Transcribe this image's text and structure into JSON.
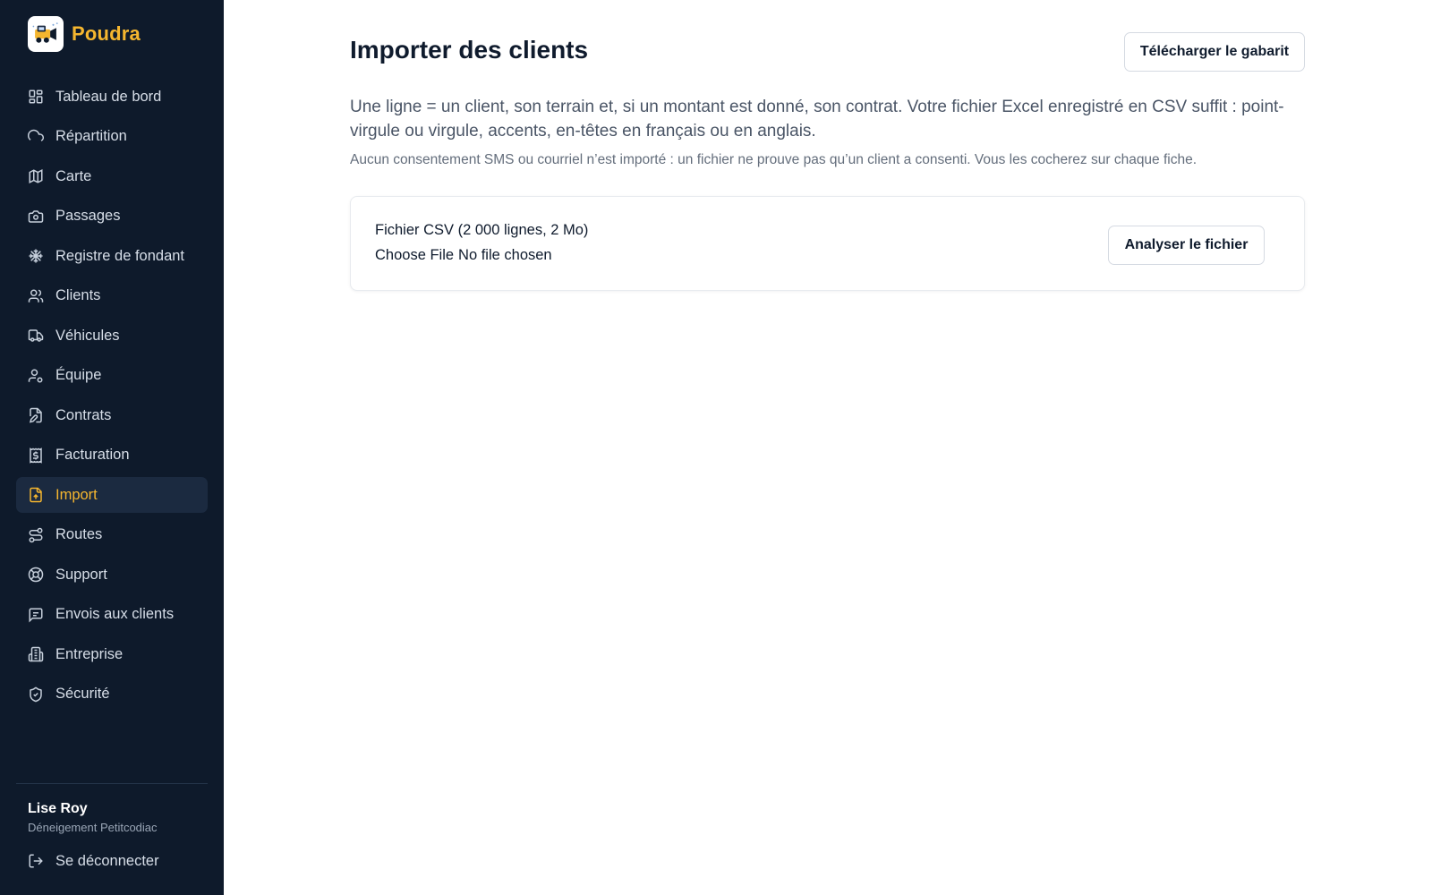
{
  "brand": {
    "name": "Poudra",
    "accent": "#f5b62f",
    "logo_icon": "snowplow-logo-icon"
  },
  "sidebar": {
    "items": [
      {
        "label": "Tableau de bord",
        "icon": "grid-dashboard-icon"
      },
      {
        "label": "Répartition",
        "icon": "cloud-snow-icon"
      },
      {
        "label": "Carte",
        "icon": "map-icon"
      },
      {
        "label": "Passages",
        "icon": "camera-icon"
      },
      {
        "label": "Registre de fondant",
        "icon": "snowflake-icon"
      },
      {
        "label": "Clients",
        "icon": "users-icon"
      },
      {
        "label": "Véhicules",
        "icon": "truck-icon"
      },
      {
        "label": "Équipe",
        "icon": "user-cog-icon"
      },
      {
        "label": "Contrats",
        "icon": "file-edit-icon"
      },
      {
        "label": "Facturation",
        "icon": "receipt-dollar-icon"
      },
      {
        "label": "Import",
        "icon": "file-upload-icon",
        "active": true
      },
      {
        "label": "Routes",
        "icon": "route-icon"
      },
      {
        "label": "Support",
        "icon": "lifebuoy-icon"
      },
      {
        "label": "Envois aux clients",
        "icon": "message-square-icon"
      },
      {
        "label": "Entreprise",
        "icon": "building-icon"
      },
      {
        "label": "Sécurité",
        "icon": "shield-check-icon"
      }
    ],
    "user": {
      "name": "Lise Roy",
      "company": "Déneigement Petitcodiac"
    },
    "logout_label": "Se déconnecter"
  },
  "main": {
    "title": "Importer des clients",
    "template_button": "Télécharger le gabarit",
    "intro": "Une ligne = un client, son terrain et, si un montant est donné, son contrat. Votre fichier Excel enregistré en CSV suffit : point-virgule ou virgule, accents, en-têtes en français ou en anglais.",
    "note": "Aucun consentement SMS ou courriel n’est importé : un fichier ne prouve pas qu’un client a consenti. Vous les cocherez sur chaque fiche.",
    "upload": {
      "label": "Fichier CSV (2 000 lignes, 2 Mo)",
      "choose_button": "Choose File",
      "file_status": "No file chosen",
      "analyze_button": "Analyser le fichier"
    }
  }
}
